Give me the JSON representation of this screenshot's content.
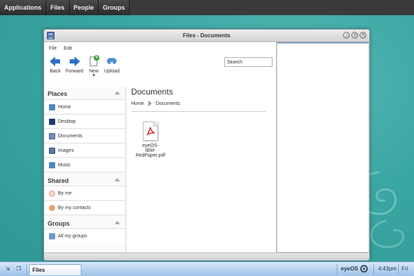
{
  "topbar": {
    "menus": [
      "Applications",
      "Files",
      "People",
      "Groups"
    ]
  },
  "window": {
    "title": "Files - Documents",
    "controls": [
      "-",
      "+",
      "×"
    ]
  },
  "filemenu": {
    "file": "File",
    "edit": "Edit"
  },
  "toolbar": {
    "back": "Back",
    "forward": "Forward",
    "new": "New",
    "upload": "Upload"
  },
  "search": {
    "value": "Search"
  },
  "sidebar": {
    "places": {
      "title": "Places",
      "items": [
        "Home",
        "Desktop",
        "Documents",
        "Images",
        "Music"
      ]
    },
    "shared": {
      "title": "Shared",
      "items": [
        "By me",
        "By my contacts"
      ]
    },
    "groups": {
      "title": "Groups",
      "items": [
        "All my groups"
      ]
    }
  },
  "main": {
    "heading": "Documents",
    "breadcrumb": [
      "Home",
      "Documents"
    ],
    "files": [
      {
        "name_line1": "eyeOS-",
        "name_line2": "IBM-RedPaper.pdf",
        "icon": "pdf-icon"
      }
    ]
  },
  "taskbar": {
    "task": "Files",
    "brand": "eyeOS",
    "time": "4:43pm",
    "day": "Fri"
  },
  "colors": {
    "desktop": "#3aa6a2",
    "accent": "#2f6fc0",
    "pdf": "#d21f1f"
  }
}
